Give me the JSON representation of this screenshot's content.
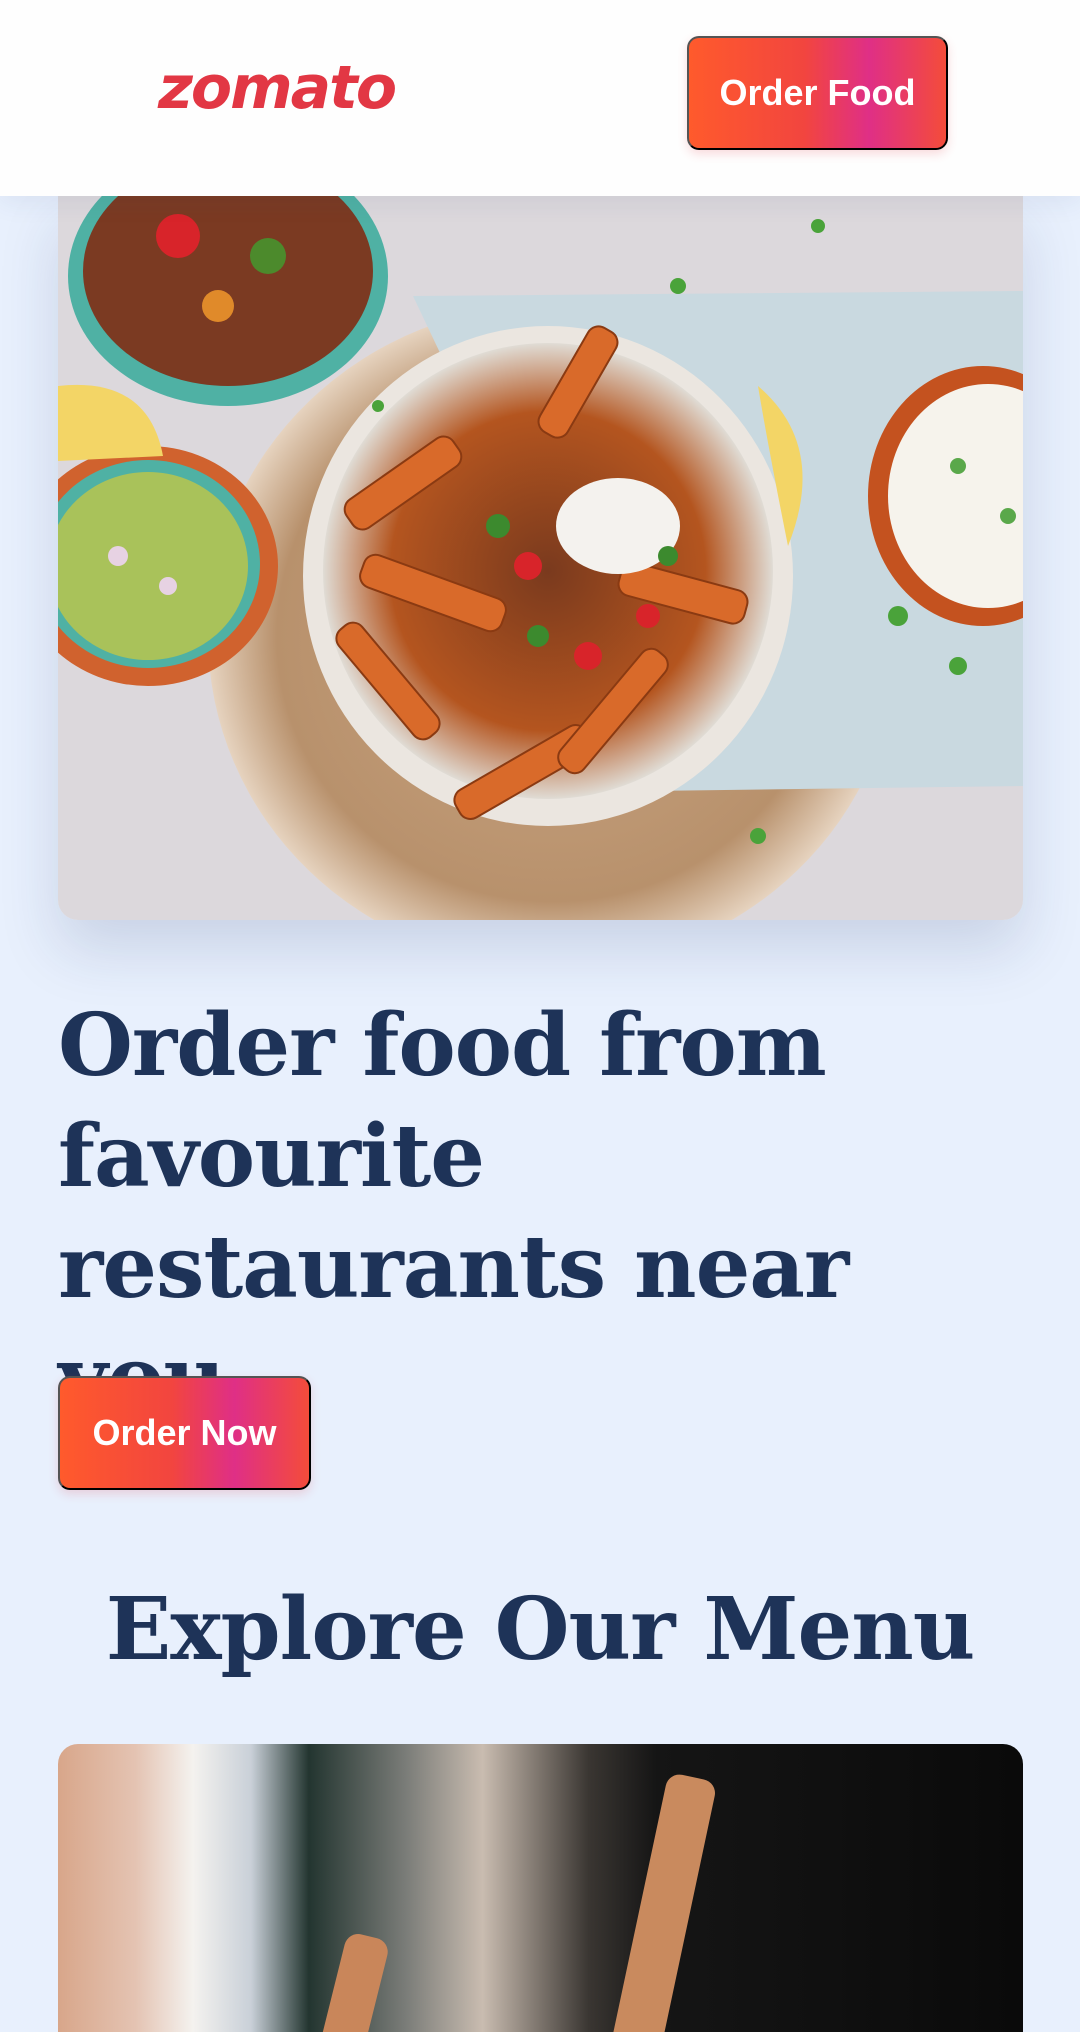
{
  "header": {
    "logo_text": "zomato",
    "order_food_label": "Order Food"
  },
  "hero": {
    "image_alt": "food-platter-image",
    "headline": "Order food from favourite restaurants near you.",
    "order_now_label": "Order Now"
  },
  "menu_section": {
    "title": "Explore Our Menu",
    "image_alt": "menu-item-image"
  },
  "colors": {
    "brand_red": "#e23744",
    "heading_navy": "#1e3358",
    "background": "#e8f0fd"
  }
}
